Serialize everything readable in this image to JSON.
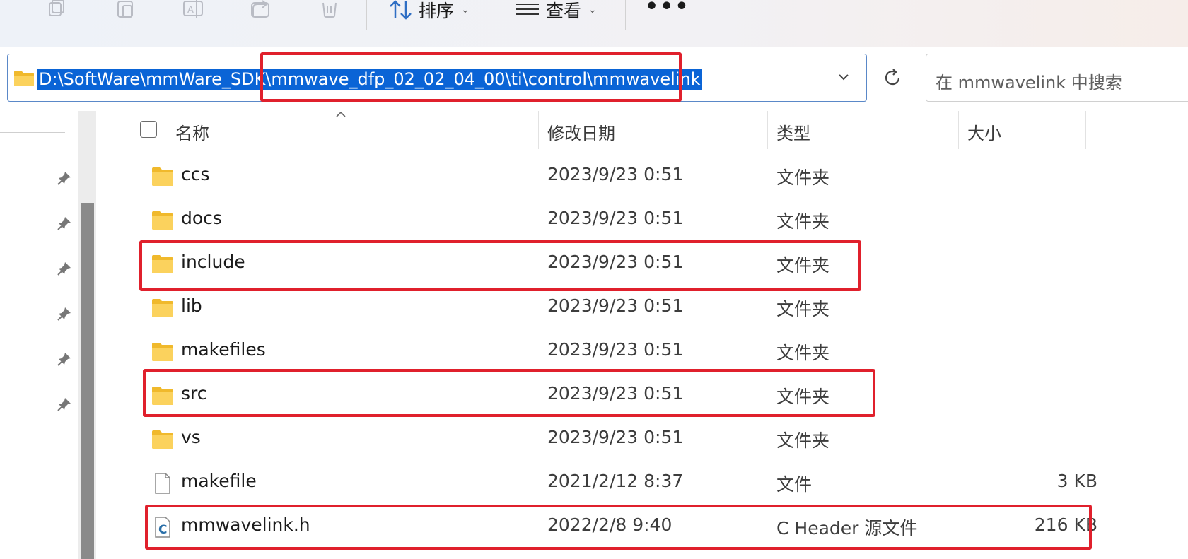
{
  "toolbar": {
    "icons": [
      "copy-icon",
      "paste-icon",
      "rename-icon",
      "share-icon",
      "delete-icon"
    ],
    "sort_label": "排序",
    "view_label": "查看",
    "more_label": "•••"
  },
  "address_bar": {
    "path": "D:\\SoftWare\\mmWare_SDK\\mmwave_dfp_02_02_04_00\\ti\\control\\mmwavelink"
  },
  "search": {
    "placeholder": "在 mmwavelink 中搜索"
  },
  "columns": {
    "name": "名称",
    "date": "修改日期",
    "type": "类型",
    "size": "大小"
  },
  "files": [
    {
      "name": "ccs",
      "date": "2023/9/23 0:51",
      "type": "文件夹",
      "size": "",
      "icon": "folder-icon"
    },
    {
      "name": "docs",
      "date": "2023/9/23 0:51",
      "type": "文件夹",
      "size": "",
      "icon": "folder-icon"
    },
    {
      "name": "include",
      "date": "2023/9/23 0:51",
      "type": "文件夹",
      "size": "",
      "icon": "folder-icon"
    },
    {
      "name": "lib",
      "date": "2023/9/23 0:51",
      "type": "文件夹",
      "size": "",
      "icon": "folder-icon"
    },
    {
      "name": "makefiles",
      "date": "2023/9/23 0:51",
      "type": "文件夹",
      "size": "",
      "icon": "folder-icon"
    },
    {
      "name": "src",
      "date": "2023/9/23 0:51",
      "type": "文件夹",
      "size": "",
      "icon": "folder-icon"
    },
    {
      "name": "vs",
      "date": "2023/9/23 0:51",
      "type": "文件夹",
      "size": "",
      "icon": "folder-icon"
    },
    {
      "name": "makefile",
      "date": "2021/2/12 8:37",
      "type": "文件",
      "size": "3 KB",
      "icon": "file-icon"
    },
    {
      "name": "mmwavelink.h",
      "date": "2022/2/8 9:40",
      "type": "C Header 源文件",
      "size": "216 KB",
      "icon": "c-header-icon"
    }
  ],
  "colors": {
    "selection": "#0a64d6",
    "highlight": "#e0202c",
    "folder": "#f4c542"
  }
}
